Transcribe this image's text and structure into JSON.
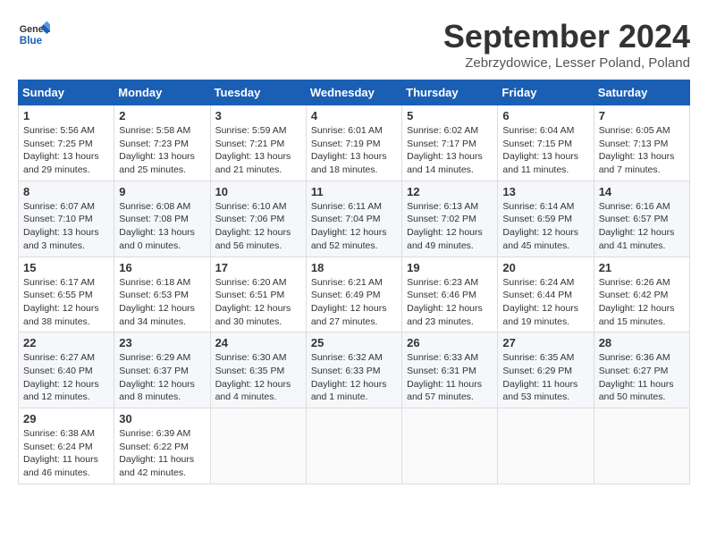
{
  "header": {
    "logo_line1": "General",
    "logo_line2": "Blue",
    "month": "September 2024",
    "location": "Zebrzydowice, Lesser Poland, Poland"
  },
  "weekdays": [
    "Sunday",
    "Monday",
    "Tuesday",
    "Wednesday",
    "Thursday",
    "Friday",
    "Saturday"
  ],
  "weeks": [
    [
      {
        "day": "1",
        "info": "Sunrise: 5:56 AM\nSunset: 7:25 PM\nDaylight: 13 hours\nand 29 minutes."
      },
      {
        "day": "2",
        "info": "Sunrise: 5:58 AM\nSunset: 7:23 PM\nDaylight: 13 hours\nand 25 minutes."
      },
      {
        "day": "3",
        "info": "Sunrise: 5:59 AM\nSunset: 7:21 PM\nDaylight: 13 hours\nand 21 minutes."
      },
      {
        "day": "4",
        "info": "Sunrise: 6:01 AM\nSunset: 7:19 PM\nDaylight: 13 hours\nand 18 minutes."
      },
      {
        "day": "5",
        "info": "Sunrise: 6:02 AM\nSunset: 7:17 PM\nDaylight: 13 hours\nand 14 minutes."
      },
      {
        "day": "6",
        "info": "Sunrise: 6:04 AM\nSunset: 7:15 PM\nDaylight: 13 hours\nand 11 minutes."
      },
      {
        "day": "7",
        "info": "Sunrise: 6:05 AM\nSunset: 7:13 PM\nDaylight: 13 hours\nand 7 minutes."
      }
    ],
    [
      {
        "day": "8",
        "info": "Sunrise: 6:07 AM\nSunset: 7:10 PM\nDaylight: 13 hours\nand 3 minutes."
      },
      {
        "day": "9",
        "info": "Sunrise: 6:08 AM\nSunset: 7:08 PM\nDaylight: 13 hours\nand 0 minutes."
      },
      {
        "day": "10",
        "info": "Sunrise: 6:10 AM\nSunset: 7:06 PM\nDaylight: 12 hours\nand 56 minutes."
      },
      {
        "day": "11",
        "info": "Sunrise: 6:11 AM\nSunset: 7:04 PM\nDaylight: 12 hours\nand 52 minutes."
      },
      {
        "day": "12",
        "info": "Sunrise: 6:13 AM\nSunset: 7:02 PM\nDaylight: 12 hours\nand 49 minutes."
      },
      {
        "day": "13",
        "info": "Sunrise: 6:14 AM\nSunset: 6:59 PM\nDaylight: 12 hours\nand 45 minutes."
      },
      {
        "day": "14",
        "info": "Sunrise: 6:16 AM\nSunset: 6:57 PM\nDaylight: 12 hours\nand 41 minutes."
      }
    ],
    [
      {
        "day": "15",
        "info": "Sunrise: 6:17 AM\nSunset: 6:55 PM\nDaylight: 12 hours\nand 38 minutes."
      },
      {
        "day": "16",
        "info": "Sunrise: 6:18 AM\nSunset: 6:53 PM\nDaylight: 12 hours\nand 34 minutes."
      },
      {
        "day": "17",
        "info": "Sunrise: 6:20 AM\nSunset: 6:51 PM\nDaylight: 12 hours\nand 30 minutes."
      },
      {
        "day": "18",
        "info": "Sunrise: 6:21 AM\nSunset: 6:49 PM\nDaylight: 12 hours\nand 27 minutes."
      },
      {
        "day": "19",
        "info": "Sunrise: 6:23 AM\nSunset: 6:46 PM\nDaylight: 12 hours\nand 23 minutes."
      },
      {
        "day": "20",
        "info": "Sunrise: 6:24 AM\nSunset: 6:44 PM\nDaylight: 12 hours\nand 19 minutes."
      },
      {
        "day": "21",
        "info": "Sunrise: 6:26 AM\nSunset: 6:42 PM\nDaylight: 12 hours\nand 15 minutes."
      }
    ],
    [
      {
        "day": "22",
        "info": "Sunrise: 6:27 AM\nSunset: 6:40 PM\nDaylight: 12 hours\nand 12 minutes."
      },
      {
        "day": "23",
        "info": "Sunrise: 6:29 AM\nSunset: 6:37 PM\nDaylight: 12 hours\nand 8 minutes."
      },
      {
        "day": "24",
        "info": "Sunrise: 6:30 AM\nSunset: 6:35 PM\nDaylight: 12 hours\nand 4 minutes."
      },
      {
        "day": "25",
        "info": "Sunrise: 6:32 AM\nSunset: 6:33 PM\nDaylight: 12 hours\nand 1 minute."
      },
      {
        "day": "26",
        "info": "Sunrise: 6:33 AM\nSunset: 6:31 PM\nDaylight: 11 hours\nand 57 minutes."
      },
      {
        "day": "27",
        "info": "Sunrise: 6:35 AM\nSunset: 6:29 PM\nDaylight: 11 hours\nand 53 minutes."
      },
      {
        "day": "28",
        "info": "Sunrise: 6:36 AM\nSunset: 6:27 PM\nDaylight: 11 hours\nand 50 minutes."
      }
    ],
    [
      {
        "day": "29",
        "info": "Sunrise: 6:38 AM\nSunset: 6:24 PM\nDaylight: 11 hours\nand 46 minutes."
      },
      {
        "day": "30",
        "info": "Sunrise: 6:39 AM\nSunset: 6:22 PM\nDaylight: 11 hours\nand 42 minutes."
      },
      {
        "day": "",
        "info": ""
      },
      {
        "day": "",
        "info": ""
      },
      {
        "day": "",
        "info": ""
      },
      {
        "day": "",
        "info": ""
      },
      {
        "day": "",
        "info": ""
      }
    ]
  ]
}
